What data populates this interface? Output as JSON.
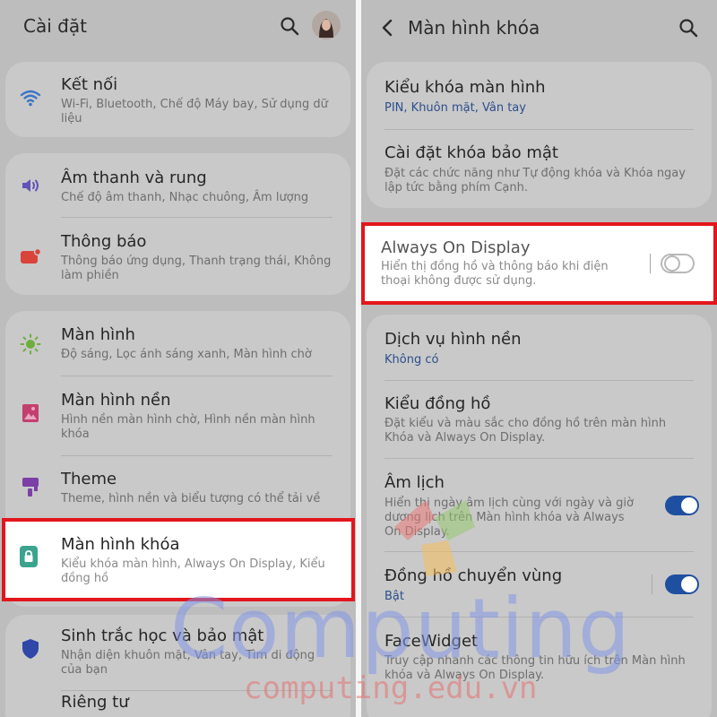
{
  "left": {
    "title": "Cài đặt",
    "items": [
      {
        "title": "Kết nối",
        "subtitle": "Wi-Fi, Bluetooth, Chế độ Máy bay, Sử dụng dữ liệu"
      },
      {
        "title": "Âm thanh và rung",
        "subtitle": "Chế độ âm thanh, Nhạc chuông, Âm lượng"
      },
      {
        "title": "Thông báo",
        "subtitle": "Thông báo ứng dụng, Thanh trạng thái, Không làm phiền"
      },
      {
        "title": "Màn hình",
        "subtitle": "Độ sáng, Lọc ánh sáng xanh, Màn hình chờ"
      },
      {
        "title": "Màn hình nền",
        "subtitle": "Hình nền màn hình chờ, Hình nền màn hình khóa"
      },
      {
        "title": "Theme",
        "subtitle": "Theme, hình nền và biểu tượng có thể tải về"
      },
      {
        "title": "Màn hình khóa",
        "subtitle": "Kiểu khóa màn hình, Always On Display, Kiểu đồng hồ"
      },
      {
        "title": "Sinh trắc học và bảo mật",
        "subtitle": "Nhận diện khuôn mặt, Vân tay, Tìm di động của bạn"
      },
      {
        "title": "Riêng tư"
      }
    ]
  },
  "right": {
    "title": "Màn hình khóa",
    "items": [
      {
        "title": "Kiểu khóa màn hình",
        "subtitle": "PIN, Khuôn mặt, Vân tay"
      },
      {
        "title": "Cài đặt khóa bảo mật",
        "subtitle": "Đặt các chức năng như Tự động khóa và Khóa ngay lập tức bằng phím Cạnh."
      },
      {
        "title": "Always On Display",
        "subtitle": "Hiển thị đồng hồ và thông báo khi điện thoại không được sử dụng.",
        "toggle": "off"
      },
      {
        "title": "Dịch vụ hình nền",
        "subtitle": "Không có"
      },
      {
        "title": "Kiểu đồng hồ",
        "subtitle": "Đặt kiểu và màu sắc cho đồng hồ trên màn hình Khóa và Always On Display."
      },
      {
        "title": "Âm lịch",
        "subtitle": "Hiển thị ngày âm lịch cùng với ngày và giờ dương lịch trên Màn hình khóa và Always On Display.",
        "toggle": "on"
      },
      {
        "title": "Đồng hồ chuyển vùng",
        "subtitle": "Bật",
        "toggle": "on"
      },
      {
        "title": "FaceWidget",
        "subtitle": "Truy cập nhanh các thông tin hữu ích trên Màn hình khóa và Always On Display."
      }
    ]
  },
  "watermark": {
    "brand": "Computing",
    "url": "computing.edu.vn"
  },
  "colors": {
    "highlight": "#e3161c",
    "toggle_on": "#1f4fa0",
    "link_blue": "#2c4f8c"
  }
}
